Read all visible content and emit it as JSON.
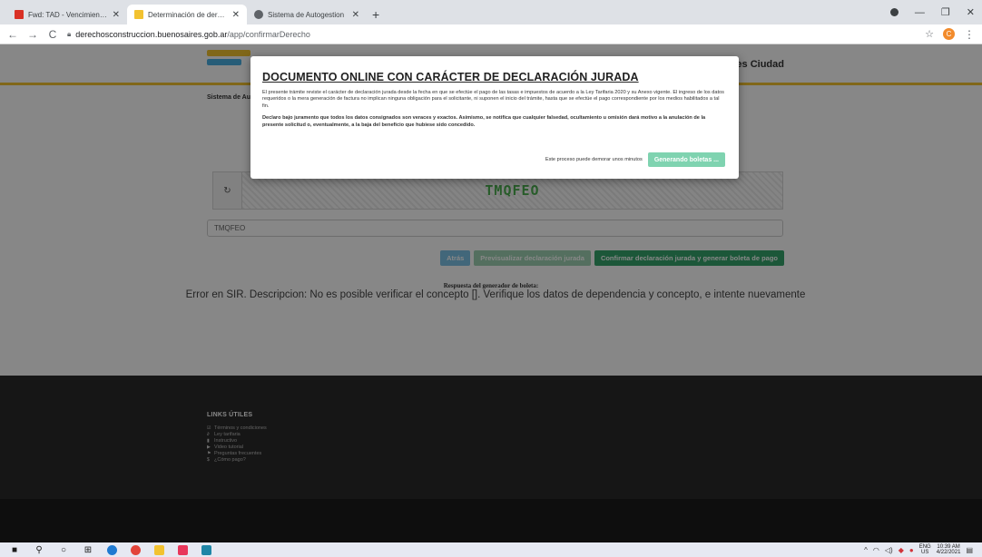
{
  "browser": {
    "tabs": [
      {
        "title": "Fwd: TAD - Vencimiento de Pode",
        "favicon_color": "#d93025"
      },
      {
        "title": "Determinación de derechos de C",
        "favicon_color": "#f2c230"
      },
      {
        "title": "Sistema de Autogestion",
        "favicon_color": "#5f6368"
      }
    ],
    "new_tab_label": "+",
    "url_host": "derechosconstruccion.buenosaires.gob.ar",
    "url_path": "/app/confirmarDerecho",
    "profile_initial": "C"
  },
  "site": {
    "header_right_text": "Aires Ciudad",
    "subnav_text": "Sistema de Aut"
  },
  "modal": {
    "title": "DOCUMENTO ONLINE CON CARÁCTER DE DECLARACIÓN JURADA",
    "paragraph1": "El presente trámite reviste el carácter de declaración jurada desde la fecha en que se efectúe el pago de las tasas e impuestos de acuerdo a la Ley Tarifaria 2020 y su Anexo vigente. El ingreso de los datos requeridos o la mera generación de factura no implican ninguna obligación para el solicitante, ni suponen el inicio del trámite, hasta que se efectúe el pago correspondiente por los medios habilitados a tal fin.",
    "paragraph2": "Declaro bajo juramento que todos los datos consignados son veraces y exactos. Asimismo, se notifica que cualquier falsedad, ocultamiento u omisión dará motivo a la anulación de la presente solicitud o, eventualmente, a la baja del beneficio que hubiese sido concedido.",
    "note": "Este proceso puede demorar unos minutos",
    "generating_button": "Generando boletas ..."
  },
  "captcha": {
    "text": "TMQFEO",
    "refresh_icon": "refresh-icon"
  },
  "form": {
    "captcha_input_value": "TMQFEO",
    "back_button": "Atrás",
    "preview_button": "Previsualizar declaración jurada",
    "confirm_button": "Confirmar declaración jurada y generar boleta de pago"
  },
  "response": {
    "label": "Respuesta del generador de boleta:",
    "error": "Error en SIR. Descripcion: No es posible verificar el concepto []. Verifique los datos de dependencia y concepto, e intente nuevamente"
  },
  "footer": {
    "title": "LINKS ÚTILES",
    "links": [
      {
        "icon": "☑",
        "label": "Términos y condiciones"
      },
      {
        "icon": "∂",
        "label": "Ley tarifaria"
      },
      {
        "icon": "▮",
        "label": "Instructivo"
      },
      {
        "icon": "▶",
        "label": "Video tutorial"
      },
      {
        "icon": "⚑",
        "label": "Preguntas frecuentes"
      },
      {
        "icon": "$",
        "label": "¿Cómo pago?"
      }
    ]
  },
  "taskbar": {
    "lang_top": "ENG",
    "lang_bottom": "US",
    "time": "10:39 AM",
    "date": "4/22/2021"
  },
  "colors": {
    "accent_green": "#36a46c",
    "brand_yellow": "#f2c230",
    "footer_dark": "#2b2b2b"
  }
}
